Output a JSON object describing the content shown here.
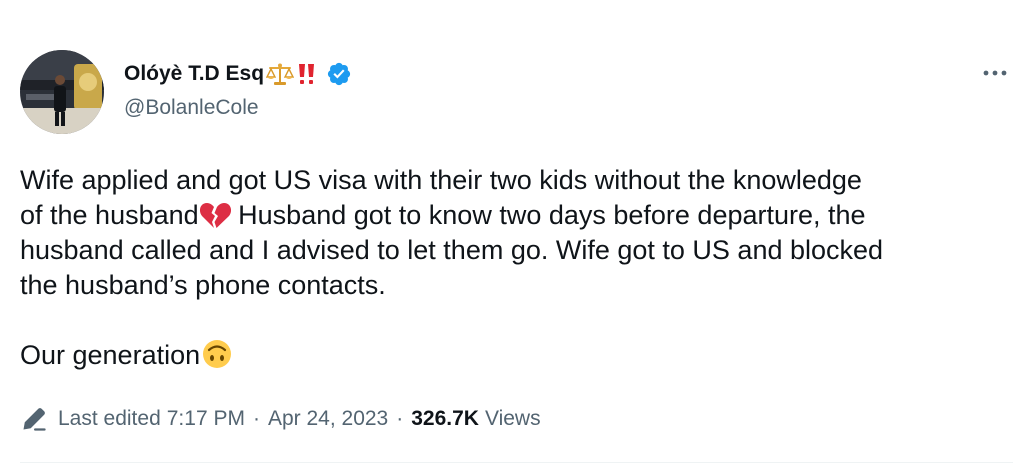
{
  "author": {
    "display_name": "Olóyè T.D Esq",
    "name_emojis": [
      "scales-emoji",
      "double-exclamation-emoji"
    ],
    "verified": true,
    "handle": "@BolanleCole"
  },
  "tweet": {
    "lines": [
      "Wife applied and got US visa with their two kids without the knowledge",
      "of the husband",
      " Husband got to know two days before departure, the",
      "husband called and I advised to let them go. Wife got to US and blocked",
      "the husband’s phone contacts.",
      "Our generation"
    ],
    "inline_emojis": [
      "broken-heart-emoji",
      "upside-down-face-emoji"
    ]
  },
  "meta": {
    "edited_label": "Last edited",
    "time": "7:17 PM",
    "separator": "·",
    "date": "Apr 24, 2023",
    "views_count": "326.7K",
    "views_label": "Views"
  },
  "colors": {
    "text_primary": "#0f1419",
    "text_secondary": "#536471",
    "verified_blue": "#1d9bf0",
    "divider": "#eff3f4"
  },
  "icons": {
    "more": "more-horizontal-icon",
    "edit": "pencil-icon",
    "verified": "verified-badge-icon"
  }
}
